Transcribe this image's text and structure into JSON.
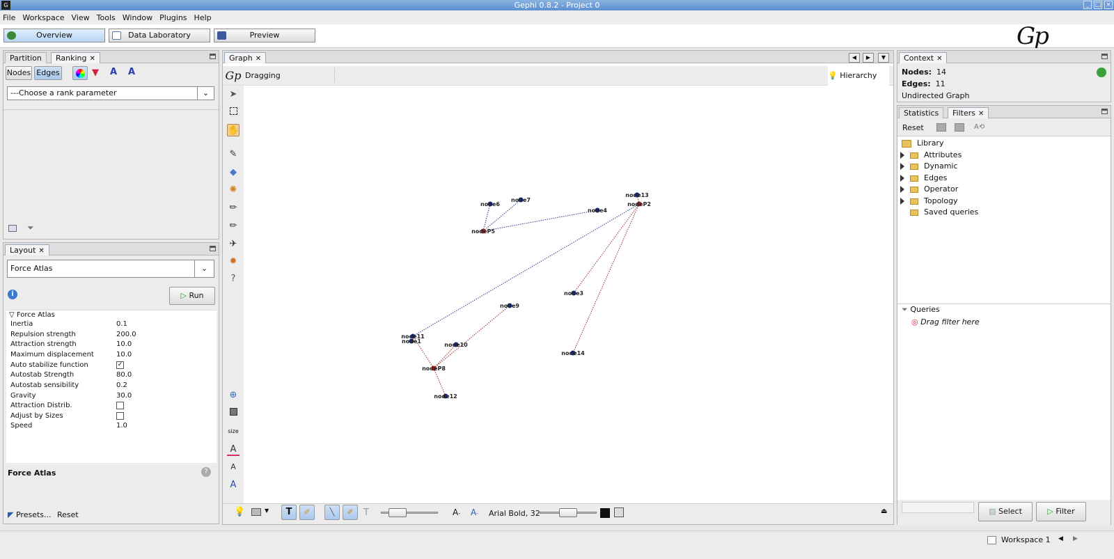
{
  "window": {
    "title": "Gephi 0.8.2 - Project 0"
  },
  "menu": [
    "File",
    "Workspace",
    "View",
    "Tools",
    "Window",
    "Plugins",
    "Help"
  ],
  "workspace_tabs": [
    {
      "label": "Overview",
      "active": true
    },
    {
      "label": "Data Laboratory",
      "active": false
    },
    {
      "label": "Preview",
      "active": false
    }
  ],
  "ranking": {
    "tabs": [
      "Partition",
      "Ranking"
    ],
    "nodes_label": "Nodes",
    "edges_label": "Edges",
    "rank_param": "---Choose a rank parameter"
  },
  "layout": {
    "tab": "Layout",
    "algorithm": "Force Atlas",
    "run_label": "Run",
    "section": "Force Atlas",
    "props": [
      {
        "k": "Inertia",
        "v": "0.1"
      },
      {
        "k": "Repulsion strength",
        "v": "200.0"
      },
      {
        "k": "Attraction strength",
        "v": "10.0"
      },
      {
        "k": "Maximum displacement",
        "v": "10.0"
      },
      {
        "k": "Auto stabilize function",
        "v": "",
        "checked": true
      },
      {
        "k": "Autostab Strength",
        "v": "80.0"
      },
      {
        "k": "Autostab sensibility",
        "v": "0.2"
      },
      {
        "k": "Gravity",
        "v": "30.0"
      },
      {
        "k": "Attraction Distrib.",
        "v": "",
        "checked": false
      },
      {
        "k": "Adjust by Sizes",
        "v": "",
        "checked": false
      },
      {
        "k": "Speed",
        "v": "1.0"
      }
    ],
    "footer_title": "Force Atlas",
    "presets_label": "Presets...",
    "reset_label": "Reset"
  },
  "graph": {
    "tab": "Graph",
    "mode": "Dragging",
    "hierarchy": "Hierarchy",
    "font": "Arial Bold, 32",
    "nodes": [
      {
        "id": "node6",
        "color": "#1a2a8a"
      },
      {
        "id": "node7",
        "color": "#1a2a8a"
      },
      {
        "id": "nodeP5",
        "color": "#b02020"
      },
      {
        "id": "node4",
        "color": "#1a2a8a"
      },
      {
        "id": "node13",
        "color": "#1a2a8a"
      },
      {
        "id": "nodeP2",
        "color": "#b02020"
      },
      {
        "id": "node3",
        "color": "#1a2a8a"
      },
      {
        "id": "node9",
        "color": "#1a2a8a"
      },
      {
        "id": "node11",
        "color": "#1a2a8a"
      },
      {
        "id": "node1",
        "color": "#1a2a8a"
      },
      {
        "id": "node10",
        "color": "#1a2a8a"
      },
      {
        "id": "nodeP8",
        "color": "#b02020"
      },
      {
        "id": "node14",
        "color": "#1a2a8a"
      },
      {
        "id": "node12",
        "color": "#1a2a8a"
      }
    ],
    "edges": [
      [
        "nodeP5",
        "node6"
      ],
      [
        "nodeP5",
        "node7"
      ],
      [
        "nodeP5",
        "node4"
      ],
      [
        "nodeP2",
        "node13"
      ],
      [
        "nodeP2",
        "node11"
      ],
      [
        "nodeP2",
        "node3"
      ],
      [
        "nodeP2",
        "node14"
      ],
      [
        "nodeP8",
        "node9"
      ],
      [
        "nodeP8",
        "node10"
      ],
      [
        "nodeP8",
        "node11"
      ],
      [
        "nodeP8",
        "node12"
      ]
    ]
  },
  "context": {
    "tab": "Context",
    "nodes_label": "Nodes:",
    "nodes": "14",
    "edges_label": "Edges:",
    "edges": "11",
    "type": "Undirected Graph"
  },
  "filters": {
    "tabs": [
      "Statistics",
      "Filters"
    ],
    "reset_label": "Reset",
    "library": "Library",
    "tree": [
      "Attributes",
      "Dynamic",
      "Edges",
      "Operator",
      "Topology"
    ],
    "saved": "Saved queries",
    "queries": "Queries",
    "drag_hint": "Drag filter here",
    "select_label": "Select",
    "filter_label": "Filter"
  },
  "status": {
    "workspace": "Workspace 1"
  }
}
